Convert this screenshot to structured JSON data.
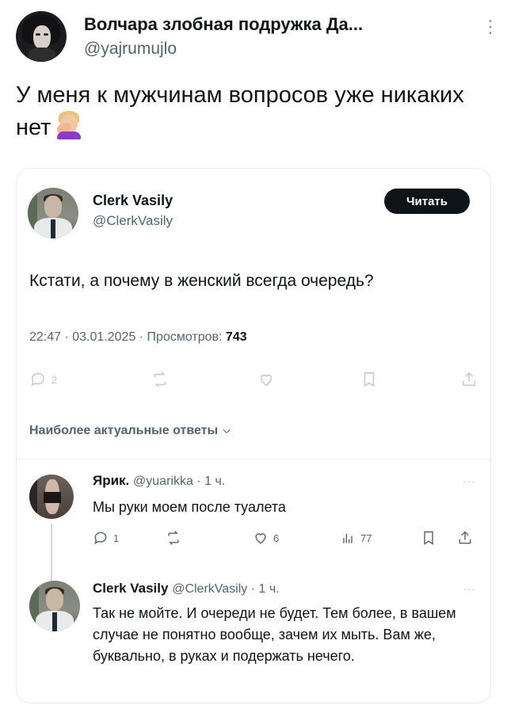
{
  "outer_tweet": {
    "author_name": "Волчара злобная подружка Да...",
    "handle": "@yajrumujlo",
    "text": "У меня к мужчинам вопросов уже никаких нет",
    "emoji": "woman-facepalming-emoji"
  },
  "quoted_tweet": {
    "author_name": "Clerk Vasily",
    "handle": "@ClerkVasily",
    "follow_label": "Читать",
    "text": "Кстати, а почему в женский всегда очередь?",
    "meta_prefix": "22:47 · 03.01.2025 · Просмотров: ",
    "views": "743",
    "actions": {
      "reply_count": "2"
    },
    "sort_label": "Наиболее актуальные ответы"
  },
  "replies": [
    {
      "author_name": "Ярик.",
      "meta": "@yuarikka · 1 ч.",
      "text": "Мы руки моем после туалета",
      "more": "···",
      "actions": {
        "reply_count": "1",
        "like_count": "6",
        "views_count": "77"
      }
    },
    {
      "author_name": "Clerk Vasily",
      "meta": "@ClerkVasily · 1 ч.",
      "text": "Так не мойте. И очереди не будет. Тем более, в вашем случае не понятно вообще, зачем их мыть. Вам же, буквально, в руках и подержать нечего.",
      "more": "···"
    }
  ],
  "outer_more": "⋮"
}
